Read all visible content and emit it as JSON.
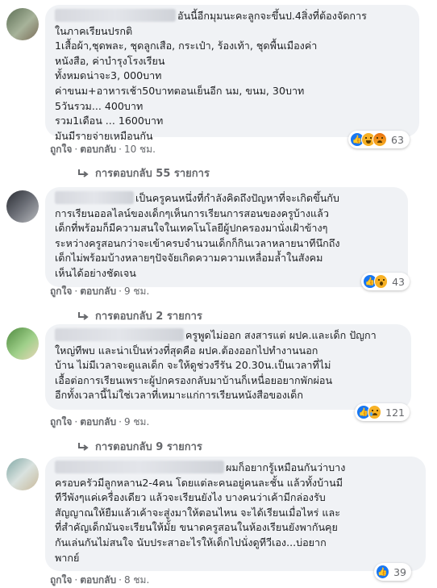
{
  "comments": [
    {
      "avatar": "avatar-photo",
      "text_lines": [
        "อันนี้อีกมุมนะคะลูกจะขึ้นป.4สิ่งที่ต้องจัดการ",
        "ในภาคเรียนปรกติ",
        "1เสื้อผ้า,ชุดพละ, ชุดลูกเสือ, กระเป๋า, ร้องเท้า, ชุดพื้นเมืองค่า",
        "หนังสือ, ค่าบำรุงโรงเรียน",
        "ทั้งหมดน่าจะ3, 000บาท",
        "ค่าขนม+อาหารเช้า50บาทตอนเย็นอีก นม, ขนม, 30บาท",
        "5วันรวม... 400บาท",
        "รวม1เดือน ... 1600บาท",
        "มันมีรายจ่ายเหมือนกัน"
      ],
      "like_label": "ถูกใจ",
      "reply_label": "ตอบกลับ",
      "time": "10 ชม.",
      "reactions": [
        "like-icon",
        "haha-icon",
        "angry-icon"
      ],
      "reaction_count": "63",
      "replies_label": "การตอบกลับ 55 รายการ"
    },
    {
      "avatar": "avatar-photo",
      "text_lines": [
        "เป็นครูคนหนึ่งที่กำลังคิดถึงปัญหาที่จะเกิดขึ้นกับ",
        "การเรียนออลไลน์ของเด็กๆเห็นการเรียนการสอนของครูบ้างแล้ว",
        "เด็กที่พร้อมก็มีความสนใจในเทคโนโลยีผู้ปกครองมานั่งเฝ้าข้างๆ",
        "ระหว่างครูสอนกว่าจะเข้าครบจำนวนเด็กก็กินเวลาหลายนาทีนึกถึง",
        "เด็กไม่พร้อมบ้างหลายๆปัจจัยเกิดความความเหลื่อมล้ำในสังคม",
        "เห็นได้อย่างชัดเจน"
      ],
      "like_label": "ถูกใจ",
      "reply_label": "ตอบกลับ",
      "time": "9 ชม.",
      "reactions": [
        "like-icon",
        "wow-icon"
      ],
      "reaction_count": "43",
      "replies_label": "การตอบกลับ 2 รายการ"
    },
    {
      "avatar": "avatar-photo",
      "text_lines": [
        "ครูพูดไม่ออก สงสารแต่ ผปค.และเด็ก ปัญกา",
        "ใหญ่ทีพบ และน่าเป็นห่วงที่สุดคือ ผปค.ต้องออกไปทำงานนอก",
        "บ้าน ไม่มีเวลาจะดูแลเด็ก จะให้ดูช่วงรีรัน 20.30น.เป็นเวลาที่ไม่",
        "เอื้อต่อการเรียนเพราะผู้ปกครองกลับมาบ้านก็เหนื่อยอยากพักผ่อน",
        "อีกทั้งเวลานี้ไม่ใช่เวลาที่เหมาะแก่การเรียนหนังสือของเด็ก"
      ],
      "like_label": "ถูกใจ",
      "reply_label": "ตอบกลับ",
      "time": "9 ชม.",
      "reactions": [
        "like-icon",
        "sad-icon"
      ],
      "reaction_count": "121",
      "replies_label": "การตอบกลับ 9 รายการ"
    },
    {
      "avatar": "avatar-photo",
      "text_lines": [
        "ผมก็อยากรู้เหมือนกันว่าบาง",
        "ครอบครัวมีลูกหลาน2-4คน โดยแต่ละคนอยู่คนละชั้น แล้วทั้งบ้านมี",
        "ทีวีพังๆแค่เครื่องเดียว แล้วจะเรียนยังไง บางคนว่าเค้ามีกล่องรับ",
        "สัญญาณให้ยืมแล้วเค้าจะสู่งมาให้ตอนไหน จะได้เรียนเมื่อไหร่ และ",
        "ที่สำคัญเด็กมันจะเรียนให้มั้ย ขนาดครูสอนในห้องเรียนยังพากันคุย",
        "กันเล่นกันไม่สนใจ นับประสาอะไรให้เด็กไปนั่งดูทีวีเอง...บ่อยาก",
        "พากย์"
      ],
      "like_label": "ถูกใจ",
      "reply_label": "ตอบกลับ",
      "time": "8 ชม.",
      "reactions": [
        "like-icon"
      ],
      "reaction_count": "39",
      "replies_label": ""
    }
  ],
  "colors": {
    "bubble": "#f0f2f5",
    "meta": "#65676b",
    "like": "#1877f2",
    "emoji": "#f7b125"
  }
}
